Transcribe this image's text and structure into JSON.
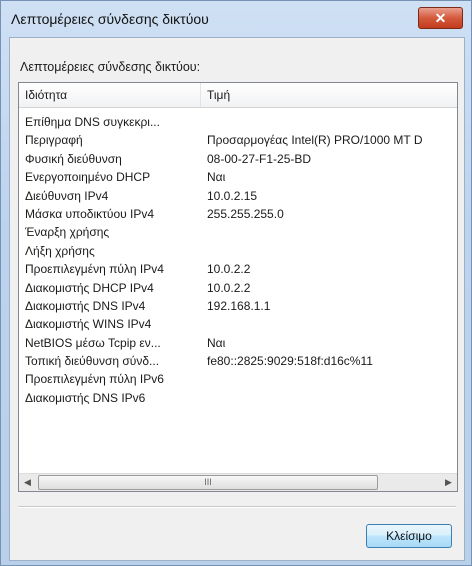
{
  "window": {
    "title": "Λεπτομέρειες σύνδεσης δικτύου",
    "close_glyph": "✕"
  },
  "group_label": "Λεπτομέρειες σύνδεσης δικτύου:",
  "table": {
    "columns": [
      "Ιδιότητα",
      "Τιμή"
    ],
    "rows": [
      {
        "property": "Επίθημα DNS συγκεκρι...",
        "value": ""
      },
      {
        "property": "Περιγραφή",
        "value": "Προσαρμογέας Intel(R) PRO/1000 MT D"
      },
      {
        "property": "Φυσική διεύθυνση",
        "value": "08-00-27-F1-25-BD"
      },
      {
        "property": "Ενεργοποιημένο DHCP",
        "value": "Ναι"
      },
      {
        "property": "Διεύθυνση IPv4",
        "value": "10.0.2.15"
      },
      {
        "property": "Μάσκα υποδικτύου IPv4",
        "value": "255.255.255.0"
      },
      {
        "property": "Έναρξη χρήσης",
        "value": ""
      },
      {
        "property": "Λήξη χρήσης",
        "value": ""
      },
      {
        "property": "Προεπιλεγμένη πύλη IPv4",
        "value": "10.0.2.2"
      },
      {
        "property": "Διακομιστής DHCP IPv4",
        "value": "10.0.2.2"
      },
      {
        "property": "Διακομιστής DNS IPv4",
        "value": "192.168.1.1"
      },
      {
        "property": "Διακομιστής WINS IPv4",
        "value": ""
      },
      {
        "property": "NetBIOS μέσω Tcpip εν...",
        "value": "Ναι"
      },
      {
        "property": "Τοπική διεύθυνση σύνδ...",
        "value": "fe80::2825:9029:518f:d16c%11"
      },
      {
        "property": "Προεπιλεγμένη πύλη IPv6",
        "value": ""
      },
      {
        "property": "Διακομιστής DNS IPv6",
        "value": ""
      }
    ]
  },
  "scrollbar": {
    "left_arrow": "◀",
    "right_arrow": "▶",
    "thumb_grip": "III"
  },
  "buttons": {
    "close_label": "Κλείσιμο"
  },
  "colors": {
    "title_bar": "#bcd3ee",
    "close_button": "#c23b1e",
    "dialog_button": "#bee6fd"
  }
}
